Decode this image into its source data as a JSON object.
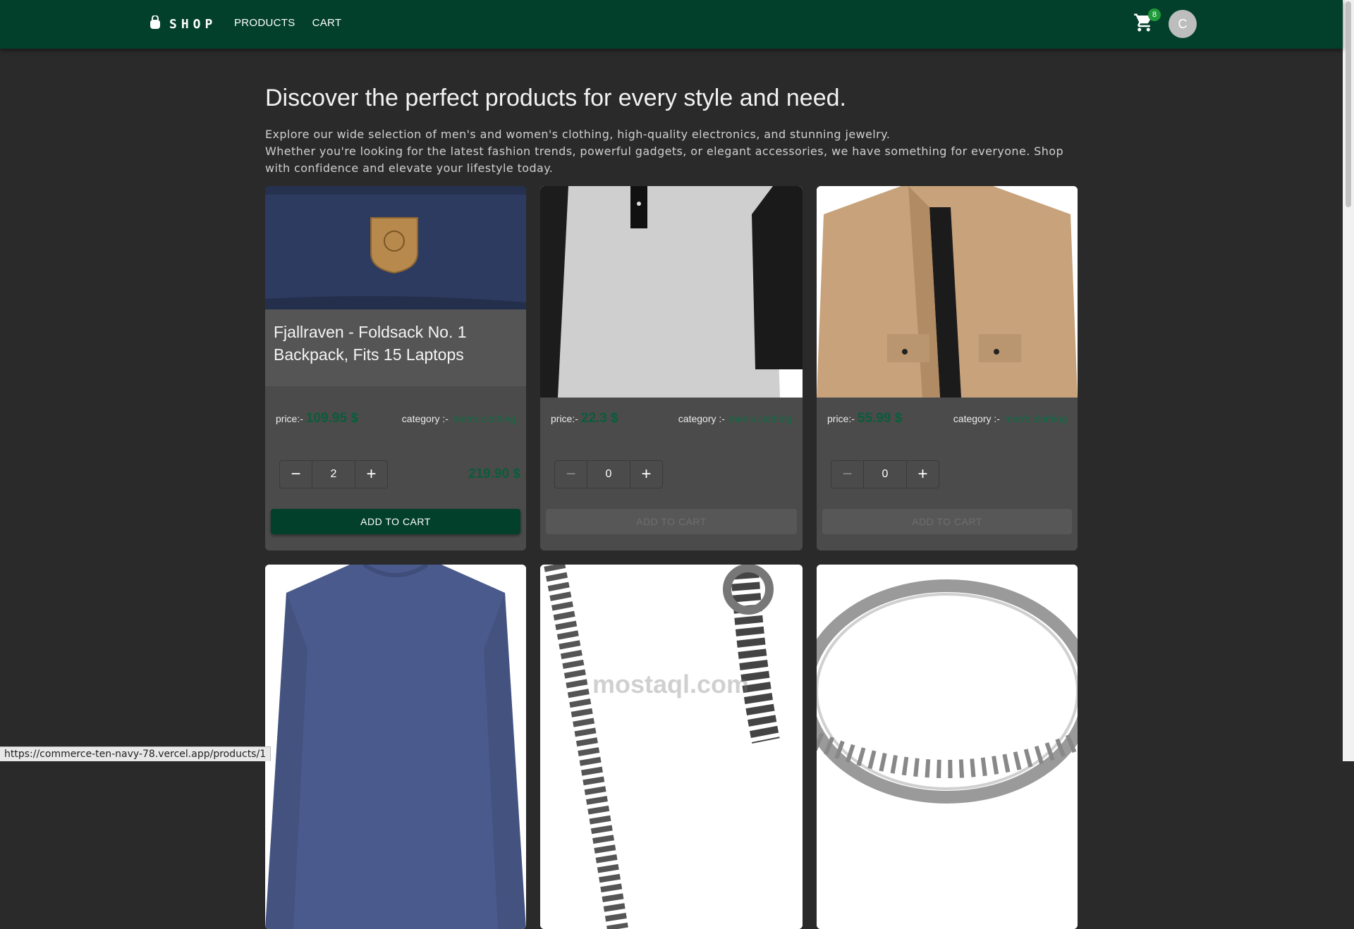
{
  "header": {
    "logo_text": "SHOP",
    "nav": [
      "PRODUCTS",
      "CART"
    ],
    "cart_count": "8",
    "avatar_initial": "C",
    "brand_color": "#02402b"
  },
  "hero": {
    "title": "Discover the perfect products for every style and need.",
    "line1": "Explore our wide selection of men's and women's clothing, high-quality electronics, and stunning jewelry.",
    "line2": "Whether you're looking for the latest fashion trends, powerful gadgets, or elegant accessories, we have something for everyone. Shop with confidence and elevate your lifestyle today."
  },
  "labels": {
    "price": "price:-",
    "category": "category :-",
    "add_to_cart": "ADD TO CART"
  },
  "products": [
    {
      "title": "Fjallraven - Foldsack No. 1 Backpack, Fits 15 Laptops",
      "price": "109.95 $",
      "category": "men's clothing",
      "qty": "2",
      "total": "219.90 $",
      "image": "navy-backpack"
    },
    {
      "title": "",
      "price": "22.3 $",
      "category": "men's clothing",
      "qty": "0",
      "total": "",
      "image": "raglan-tshirt"
    },
    {
      "title": "",
      "price": "55.99 $",
      "category": "men's clothing",
      "qty": "0",
      "total": "",
      "image": "cotton-jacket"
    },
    {
      "image": "long-sleeve-shirt"
    },
    {
      "image": "chain-bracelet"
    },
    {
      "image": "diamond-ring"
    }
  ],
  "watermark": "mostaql.com",
  "status_url": "https://commerce-ten-navy-78.vercel.app/products/1"
}
